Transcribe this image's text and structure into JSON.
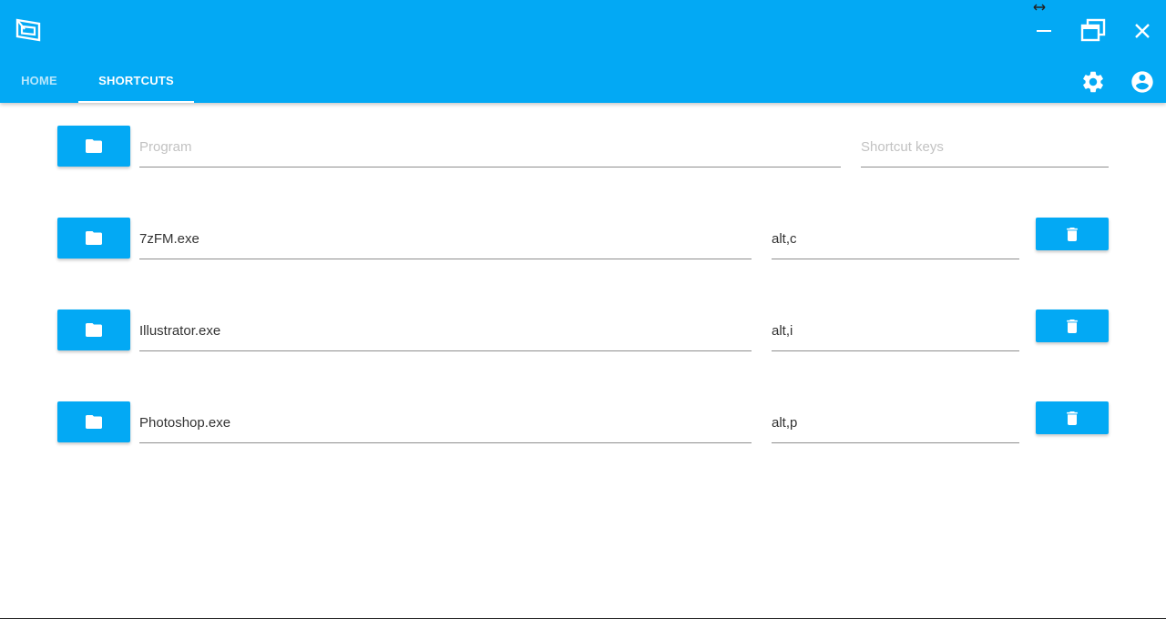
{
  "colors": {
    "primary": "#03a9f4",
    "text": "#333333",
    "placeholder": "#c2c2c2",
    "underline": "#8e8e8e"
  },
  "window_controls": [
    "minimize-icon",
    "maximize-icon",
    "close-icon"
  ],
  "tabs": [
    {
      "label": "HOME",
      "active": false
    },
    {
      "label": "SHORTCUTS",
      "active": true
    }
  ],
  "header_actions": [
    "gear-icon",
    "account-circle-icon"
  ],
  "new_shortcut": {
    "program_placeholder": "Program",
    "keys_placeholder": "Shortcut keys",
    "browse_icon": "folder-icon"
  },
  "shortcuts": [
    {
      "program": "7zFM.exe",
      "keys": "alt,c"
    },
    {
      "program": "Illustrator.exe",
      "keys": "alt,i"
    },
    {
      "program": "Photoshop.exe",
      "keys": "alt,p"
    }
  ],
  "row_icons": {
    "browse": "folder-icon",
    "delete": "trash-icon"
  }
}
